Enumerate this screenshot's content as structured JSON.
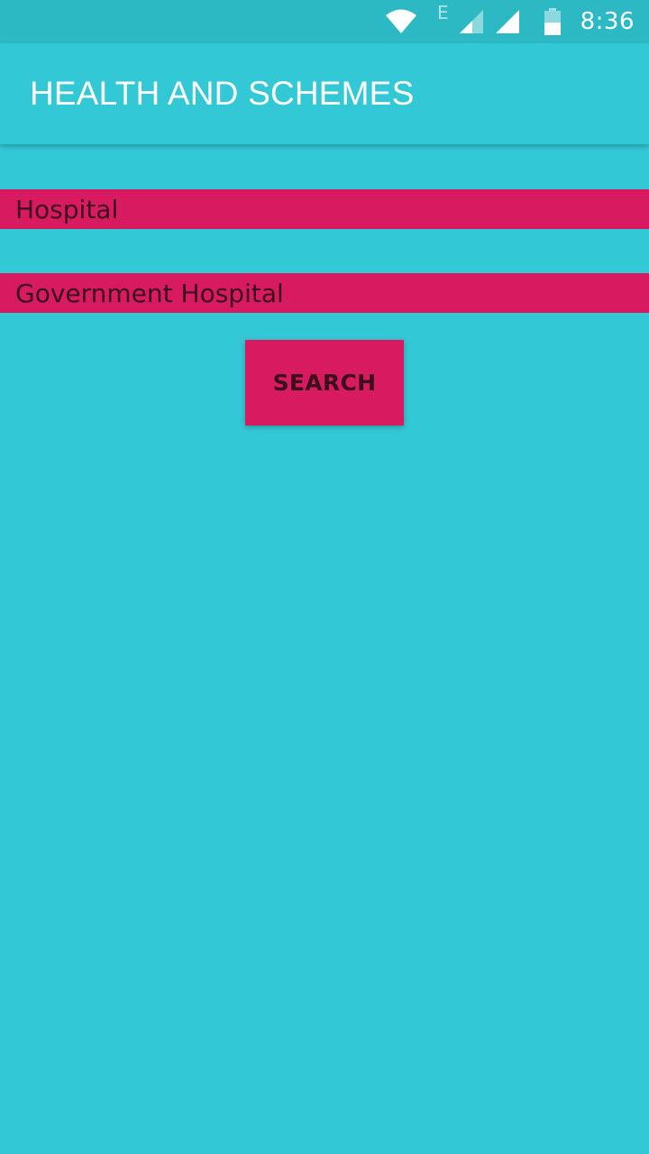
{
  "status_bar": {
    "network_type": "E",
    "time": "8:36",
    "icons": [
      "wifi-icon",
      "signal-icon",
      "signal-icon",
      "battery-icon"
    ]
  },
  "app_bar": {
    "title": "HEALTH AND SCHEMES"
  },
  "form": {
    "category_value": "Hospital",
    "type_value": "Government Hospital",
    "search_label": "SEARCH"
  },
  "colors": {
    "background": "#33C8D6",
    "status_bar": "#2CB9C4",
    "accent": "#D81B60",
    "text_dark": "#3B0F1C",
    "text_light": "#FFFFFF"
  }
}
